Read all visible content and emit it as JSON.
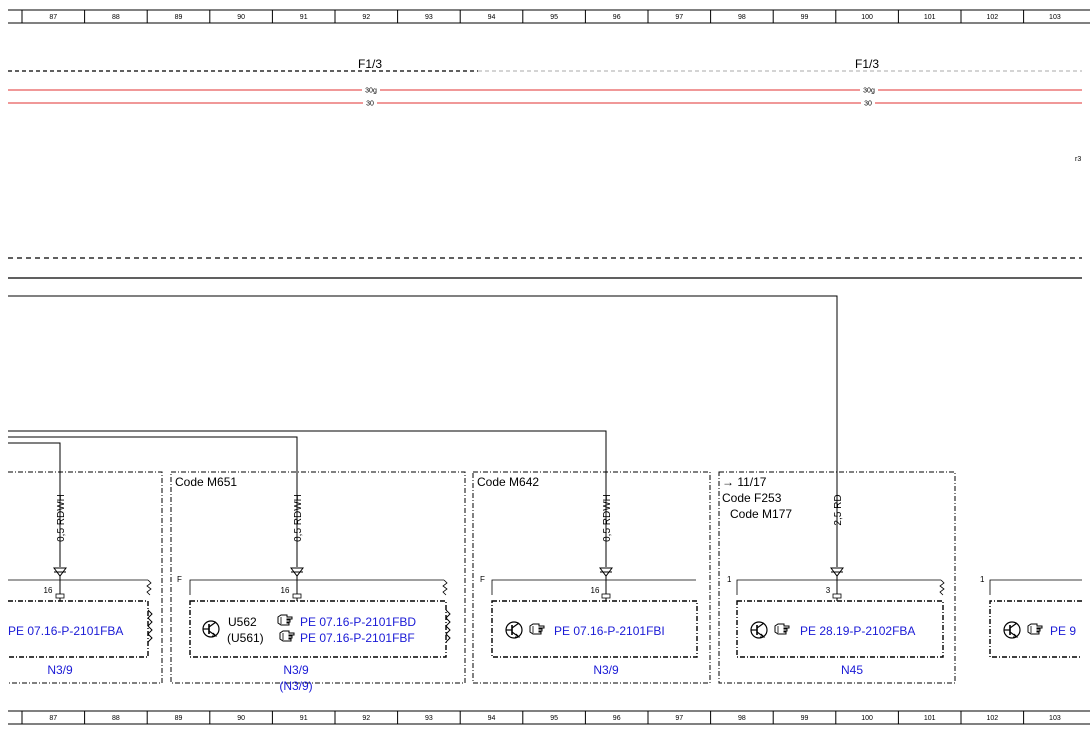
{
  "ruler": {
    "top_numbers": [
      "87",
      "88",
      "89",
      "90",
      "91",
      "92",
      "93",
      "94",
      "95",
      "96",
      "97",
      "98",
      "99",
      "100",
      "101",
      "102",
      "103"
    ],
    "bottom_numbers": [
      "87",
      "88",
      "89",
      "90",
      "91",
      "92",
      "93",
      "94",
      "95",
      "96",
      "97",
      "98",
      "99",
      "100",
      "101",
      "102",
      "103"
    ]
  },
  "fuses": [
    {
      "label": "F1/3"
    },
    {
      "label": "F1/3"
    }
  ],
  "power_lines": [
    {
      "name": "30g",
      "color": "#e03030",
      "markers": [
        "30g",
        "30g"
      ]
    },
    {
      "name": "30",
      "color": "#e03030",
      "markers": [
        "30",
        "30"
      ]
    }
  ],
  "edge_fragment": "r3",
  "modules": [
    {
      "title_lines": [],
      "side_letter": "",
      "wire_label": "0,5 RDWH",
      "pin": "16",
      "links": [
        "PE 07.16-P-2101FBA"
      ],
      "variants": [],
      "component": "N3/9",
      "component_alt": ""
    },
    {
      "title_lines": [
        "Code M651"
      ],
      "side_letter": "F",
      "wire_label": "0,5 RDWH",
      "pin": "16",
      "links": [
        "PE 07.16-P-2101FBD",
        "PE 07.16-P-2101FBF"
      ],
      "variants": [
        "U562",
        "(U561)"
      ],
      "component": "N3/9",
      "component_alt": "(N3/9)"
    },
    {
      "title_lines": [
        "Code M642"
      ],
      "side_letter": "F",
      "wire_label": "0,5 RDWH",
      "pin": "16",
      "links": [
        "PE 07.16-P-2101FBI"
      ],
      "variants": [],
      "component": "N3/9",
      "component_alt": ""
    },
    {
      "title_lines": [
        "→ 11/17",
        "Code F253",
        "Code M177"
      ],
      "side_letter": "1",
      "wire_label": "2,5 RD",
      "pin": "3",
      "links": [
        "PE 28.19-P-2102FBA"
      ],
      "variants": [],
      "component": "N45",
      "component_alt": ""
    },
    {
      "title_lines": [],
      "side_letter": "1",
      "wire_label": "",
      "pin": "",
      "links": [
        "PE 9"
      ],
      "variants": [],
      "component": "",
      "component_alt": ""
    }
  ],
  "icons": {
    "transistor": "transistor-symbol-icon",
    "pointer": "pointing-hand-icon",
    "connector": "connector-arrow-icon"
  },
  "colors": {
    "line": "#000000",
    "power": "#e03030",
    "link": "#1a1ad6"
  }
}
